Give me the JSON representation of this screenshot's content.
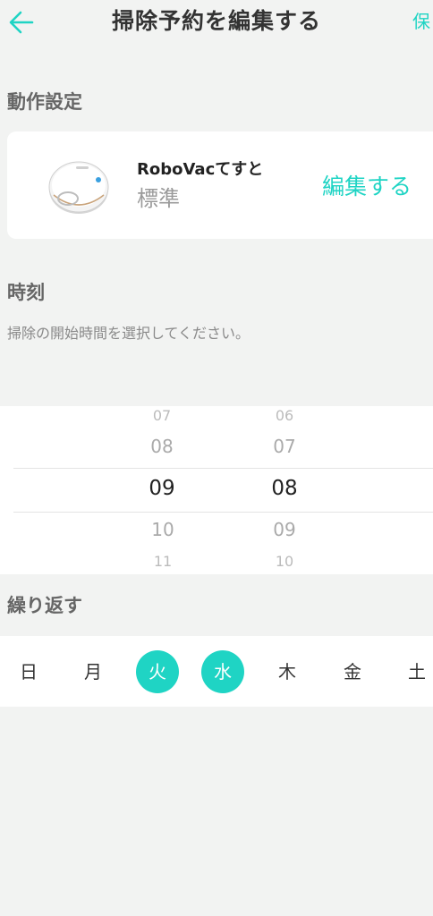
{
  "header": {
    "title": "掃除予約を編集する",
    "save_label": "保"
  },
  "action_settings": {
    "section_title": "動作設定",
    "device_name": "RoboVacてすと",
    "mode": "標準",
    "edit_label": "編集する"
  },
  "time": {
    "section_title": "時刻",
    "description": "掃除の開始時間を選択してください。",
    "hours": [
      "07",
      "08",
      "09",
      "10",
      "11"
    ],
    "minutes": [
      "06",
      "07",
      "08",
      "09",
      "10"
    ]
  },
  "repeat": {
    "section_title": "繰り返す",
    "days": [
      {
        "label": "日",
        "selected": false
      },
      {
        "label": "月",
        "selected": false
      },
      {
        "label": "火",
        "selected": true
      },
      {
        "label": "水",
        "selected": true
      },
      {
        "label": "木",
        "selected": false
      },
      {
        "label": "金",
        "selected": false
      },
      {
        "label": "土",
        "selected": false
      }
    ]
  },
  "colors": {
    "accent": "#1fd4c4",
    "background": "#f2f3f2"
  }
}
